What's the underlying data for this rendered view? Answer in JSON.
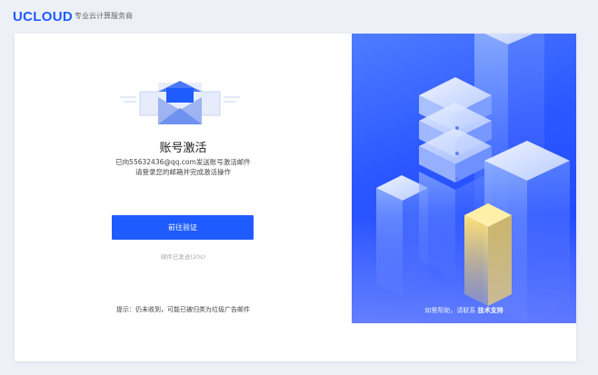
{
  "header": {
    "logo": "UCLOUD",
    "tagline": "专业云计算服务商"
  },
  "activation": {
    "title": "账号激活",
    "desc_line1": "已向55632436@qq.com发送账号激活邮件",
    "desc_line2": "请登录您的邮箱并完成激活操作",
    "go_verify_button": "前往验证",
    "resend_text": "邮件已发送(20s)",
    "tip": "提示：仍未收到，可能已被归类为垃圾广告邮件"
  },
  "promo": {
    "help_prefix": "如需帮助，请联系",
    "help_link": "技术支持"
  },
  "colors": {
    "brand": "#1f5cff",
    "panel_bg": "#2c57ff",
    "page_bg": "#edf0f7",
    "highlight_block": "#f5cf42"
  },
  "icons": {
    "logo": "ucloud-logo",
    "illustration": "envelope-icon",
    "art": "server-blocks-illustration"
  }
}
